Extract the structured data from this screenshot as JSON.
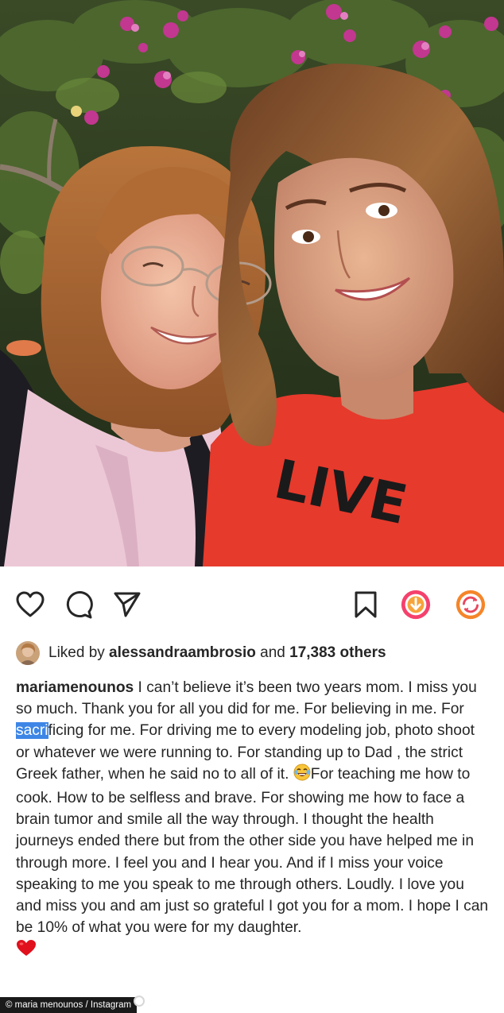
{
  "post": {
    "photo_alt": "Selfie of two women smiling outdoors in front of a bougainvillea bush",
    "shirt_text": "LIVE"
  },
  "actions": {
    "like_icon": "heart-outline-icon",
    "comment_icon": "comment-bubble-icon",
    "share_icon": "paper-plane-icon",
    "save_icon": "bookmark-icon",
    "download_icon": "download-circle-icon",
    "repost_icon": "repost-circle-icon"
  },
  "likes": {
    "prefix": "Liked by ",
    "liker": "alessandraambrosio",
    "middle": " and ",
    "others": "17,383 others"
  },
  "caption": {
    "username": "mariamenounos",
    "text_before_selection": " I can’t believe it’s been two years mom. I miss you so much. Thank you for all you did for me. For believing in me. For ",
    "selected_text": "sacri",
    "text_after_selection": "ficing for me. For driving me to every modeling job, photo shoot or whatever we were running to. For standing up to Dad , the strict Greek father, when he said no to all of it. ",
    "text_after_emoji": "For teaching me how to cook. How to be selfless and brave. For showing me how to face a brain tumor and smile all the way through. I thought the health journeys ended there but from the other side you have helped me in through more. I feel you and I hear you. And if I miss your voice speaking to me you speak to me through others. Loudly. I love you and miss you and am just so grateful I got you for a mom. I hope I can be 10% of what you were for my daughter.",
    "emoji_laugh": "tears-of-joy-emoji",
    "emoji_heart": "red-heart-emoji"
  },
  "credit": {
    "text": "© maria menounos / Instagram"
  },
  "colors": {
    "text": "#262626",
    "selection": "#3d86e6",
    "download_accent": "#f5416c",
    "repost_accent": "#f58529",
    "heart_red": "#e0101c"
  }
}
